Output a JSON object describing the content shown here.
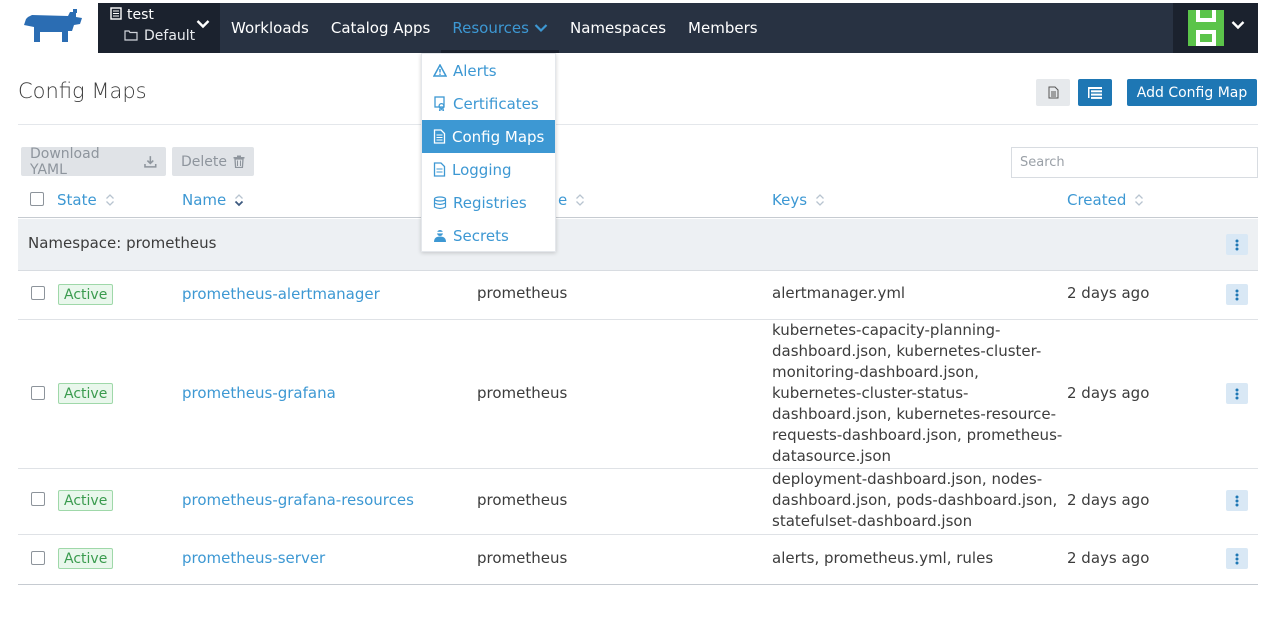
{
  "nav": {
    "cluster": "test",
    "project": "Default",
    "links": [
      "Workloads",
      "Catalog Apps",
      "Resources",
      "Namespaces",
      "Members"
    ]
  },
  "dropdown": {
    "items": [
      "Alerts",
      "Certificates",
      "Config Maps",
      "Logging",
      "Registries",
      "Secrets"
    ]
  },
  "page": {
    "title": "Config Maps",
    "add_button": "Add Config Map",
    "download_yaml": "Download YAML",
    "delete": "Delete",
    "search_placeholder": "Search"
  },
  "table": {
    "headers": {
      "state": "State",
      "name": "Name",
      "namespace": "e",
      "keys": "Keys",
      "created": "Created"
    },
    "group": "Namespace: prometheus",
    "rows": [
      {
        "state": "Active",
        "name": "prometheus-alertmanager",
        "namespace": "prometheus",
        "keys": "alertmanager.yml",
        "created": "2 days ago"
      },
      {
        "state": "Active",
        "name": "prometheus-grafana",
        "namespace": "prometheus",
        "keys": "kubernetes-capacity-planning-dashboard.json, kubernetes-cluster-monitoring-dashboard.json, kubernetes-cluster-status-dashboard.json, kubernetes-resource-requests-dashboard.json, prometheus-datasource.json",
        "created": "2 days ago"
      },
      {
        "state": "Active",
        "name": "prometheus-grafana-resources",
        "namespace": "prometheus",
        "keys": "deployment-dashboard.json, nodes-dashboard.json, pods-dashboard.json, statefulset-dashboard.json",
        "created": "2 days ago"
      },
      {
        "state": "Active",
        "name": "prometheus-server",
        "namespace": "prometheus",
        "keys": "alerts, prometheus.yml, rules",
        "created": "2 days ago"
      }
    ]
  },
  "colors": {
    "nav_bg": "#283242",
    "nav_dark": "#1b222e",
    "link": "#3d98d3",
    "primary": "#1e77b4",
    "active_green": "#3a9b4e"
  },
  "icons": [
    "rancher-logo",
    "cluster-icon",
    "project-folder-icon",
    "chevron-down-icon",
    "alert-icon",
    "certificate-icon",
    "config-map-icon",
    "logging-icon",
    "registries-icon",
    "secrets-icon",
    "file-icon",
    "tree-view-icon",
    "download-icon",
    "trash-icon",
    "sort-icon",
    "kebab-icon"
  ]
}
